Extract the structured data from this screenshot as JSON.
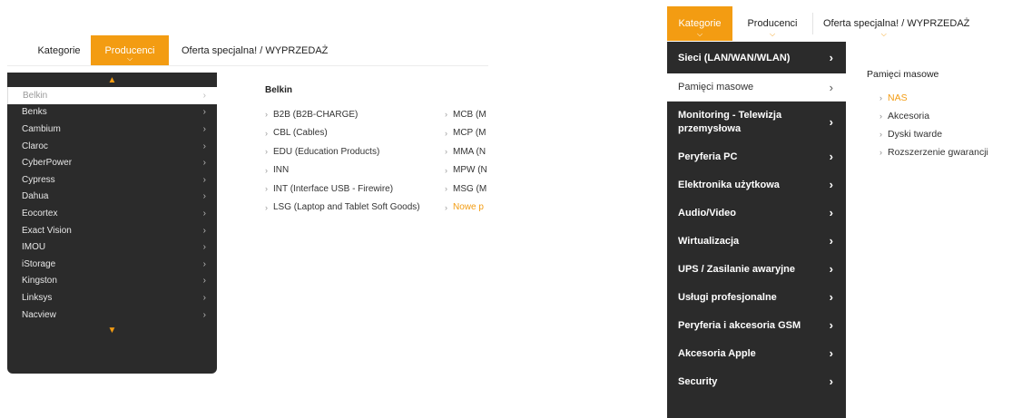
{
  "panel1": {
    "tabs": [
      "Kategorie",
      "Producenci",
      "Oferta specjalna! / WYPRZEDAŻ"
    ],
    "menu_items": [
      "Belkin",
      "Benks",
      "Cambium",
      "Claroc",
      "CyberPower",
      "Cypress",
      "Dahua",
      "Eocortex",
      "Exact Vision",
      "IMOU",
      "iStorage",
      "Kingston",
      "Linksys",
      "Nacview"
    ],
    "submenu_title": "Belkin",
    "col1": [
      "B2B (B2B-CHARGE)",
      "CBL (Cables)",
      "EDU (Education Products)",
      "INN",
      "INT (Interface USB - Firewire)",
      "LSG (Laptop and Tablet Soft Goods)"
    ],
    "col2": [
      "MCB (M",
      "MCP (M",
      "MMA (N",
      "MPW (N",
      "MSG (M",
      "Nowe p"
    ]
  },
  "panel2": {
    "tabs": [
      "Kategorie",
      "Producenci",
      "Oferta specjalna! / WYPRZEDAŻ"
    ],
    "menu_items": [
      "Sieci (LAN/WAN/WLAN)",
      "Pamięci masowe",
      "Monitoring - Telewizja przemysłowa",
      "Peryferia PC",
      "Elektronika użytkowa",
      "Audio/Video",
      "Wirtualizacja",
      "UPS / Zasilanie awaryjne",
      "Usługi profesjonalne",
      "Peryferia i akcesoria GSM",
      "Akcesoria Apple",
      "Security"
    ],
    "submenu_title": "Pamięci masowe",
    "sub_links": [
      "NAS",
      "Akcesoria",
      "Dyski twarde",
      "Rozszerzenie gwarancji"
    ]
  },
  "icons": {
    "chevron_right": "›",
    "chevron_down": "⌄",
    "chevron_up": "⌃"
  },
  "colors": {
    "accent": "#f39c12",
    "menu_bg": "#2b2b2b"
  }
}
